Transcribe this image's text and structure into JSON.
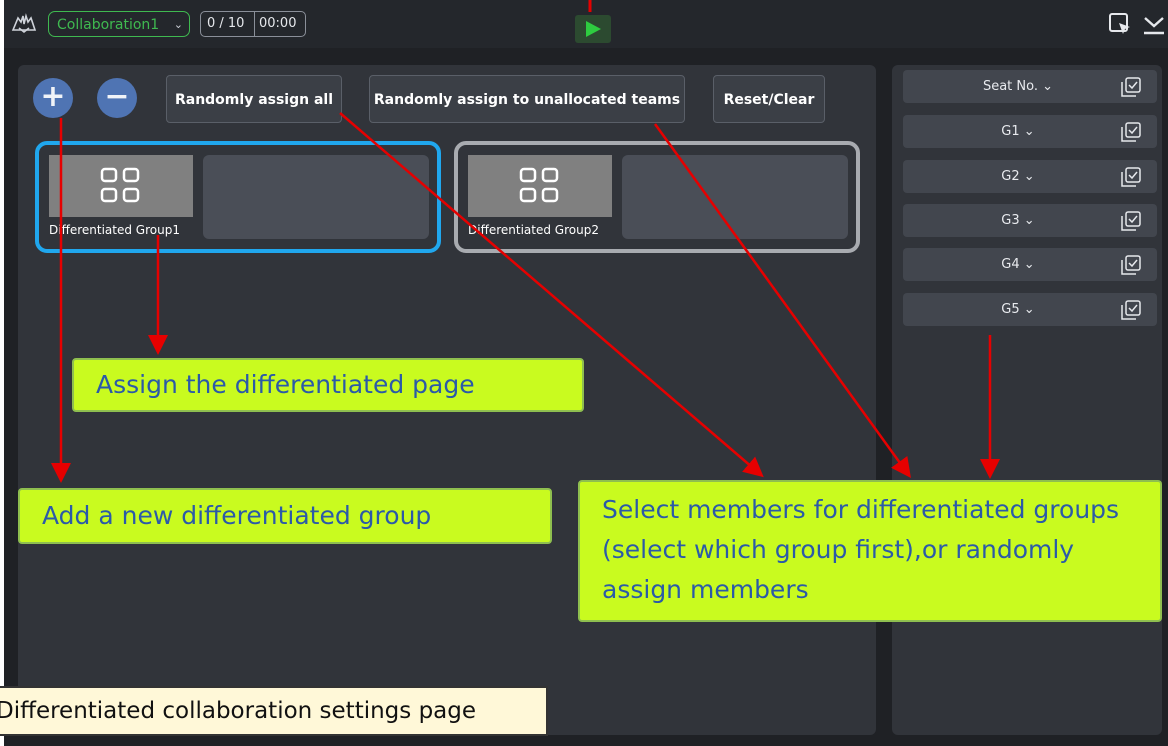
{
  "topbar": {
    "collaboration_label": "Collaboration1",
    "counter": "0 / 10",
    "timer": "00:00"
  },
  "left_panel": {
    "buttons": {
      "randomly_assign_all": "Randomly assign all",
      "randomly_assign_unallocated": "Randomly assign to unallocated teams",
      "reset_clear": "Reset/Clear"
    },
    "groups": [
      {
        "name": "Differentiated Group1",
        "selected": true
      },
      {
        "name": "Differentiated Group2",
        "selected": false
      }
    ]
  },
  "right_panel": {
    "rows": [
      {
        "label": "Seat No."
      },
      {
        "label": "G1"
      },
      {
        "label": "G2"
      },
      {
        "label": "G3"
      },
      {
        "label": "G4"
      },
      {
        "label": "G5"
      }
    ]
  },
  "annotations": {
    "assign_page": "Assign the differentiated page",
    "add_group": "Add a new differentiated group",
    "select_members": "Select members for differentiated groups (select which group first),or randomly assign members",
    "settings_page": "Differentiated collaboration settings page"
  },
  "colors": {
    "selected_border": "#20a7ee",
    "callout_bg": "#c9fb1f",
    "accent_green": "#3fb950",
    "arrow_red": "#e60000"
  }
}
